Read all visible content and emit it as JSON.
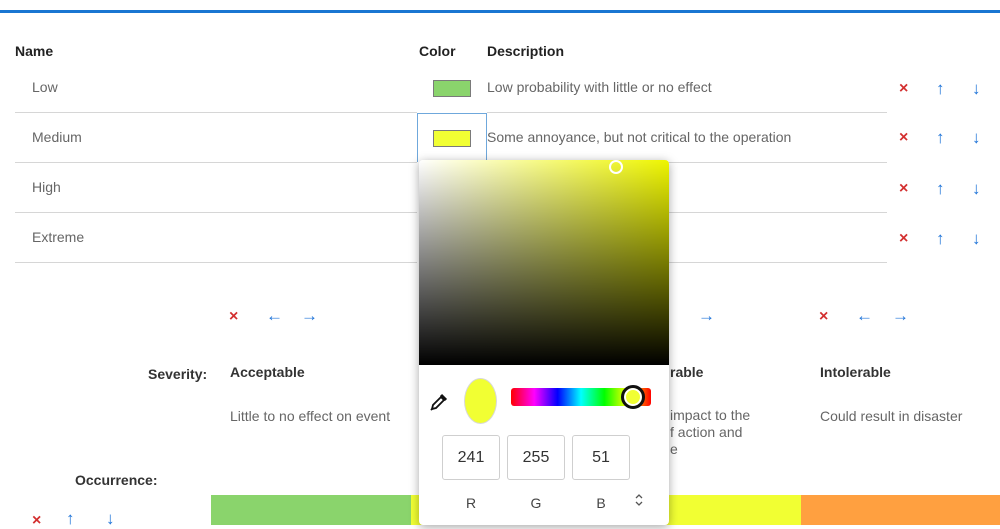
{
  "table": {
    "headers": {
      "name": "Name",
      "color": "Color",
      "description": "Description"
    },
    "rows": [
      {
        "name": "Low",
        "color": "#8ad46c",
        "description": "Low probability with little or no effect"
      },
      {
        "name": "Medium",
        "color": "#f1ff33",
        "description": "Some annoyance, but not critical to the operation"
      },
      {
        "name": "High",
        "color": "",
        "description": ""
      },
      {
        "name": "Extreme",
        "color": "",
        "description": ""
      }
    ],
    "actions": {
      "delete": "×",
      "up": "↑",
      "down": "↓"
    }
  },
  "severity": {
    "label": "Severity:",
    "column_actions": {
      "delete": "×",
      "left": "←",
      "right": "→"
    },
    "columns": [
      {
        "title": "Acceptable",
        "description": "Little to no effect on event"
      },
      {
        "title": "rable",
        "description": "impact to the\nf action and\ne"
      },
      {
        "title": "Intolerable",
        "description": "Could result in disaster"
      }
    ]
  },
  "occurrence": {
    "label": "Occurrence:"
  },
  "matrix_colors": [
    "#8ad46c",
    "#f1ff33",
    "#f1ff33",
    "#ffa040"
  ],
  "color_picker": {
    "hex": "#f1ff33",
    "r": "241",
    "g": "255",
    "b": "51",
    "labels": {
      "r": "R",
      "g": "G",
      "b": "B"
    },
    "mode_toggle": "⌃⌄"
  },
  "colors": {
    "accent": "#1976d2",
    "delete": "#d32f2f",
    "arrow": "#1e73d8"
  }
}
